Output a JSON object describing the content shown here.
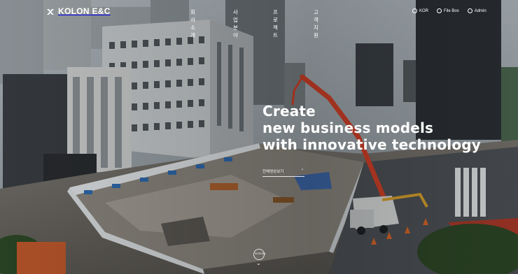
{
  "brand": {
    "name": "KOLON E&C"
  },
  "nav": [
    {
      "label": "회사소개"
    },
    {
      "label": "사업분야"
    },
    {
      "label": "프로젝트"
    },
    {
      "label": "고객지원"
    }
  ],
  "utility": [
    {
      "label": "KOR",
      "icon": "globe-icon"
    },
    {
      "label": "File Box",
      "icon": "file-box-icon"
    },
    {
      "label": "Admin",
      "icon": "admin-icon"
    }
  ],
  "hero": {
    "headline": [
      "Create",
      "new business models",
      "with innovative technology"
    ],
    "more_label": "전체영상보기",
    "scroll_label": "SCROLL"
  },
  "colors": {
    "crane": "#d9432a",
    "text": "#ffffff",
    "mast": "#c9d3d8"
  }
}
